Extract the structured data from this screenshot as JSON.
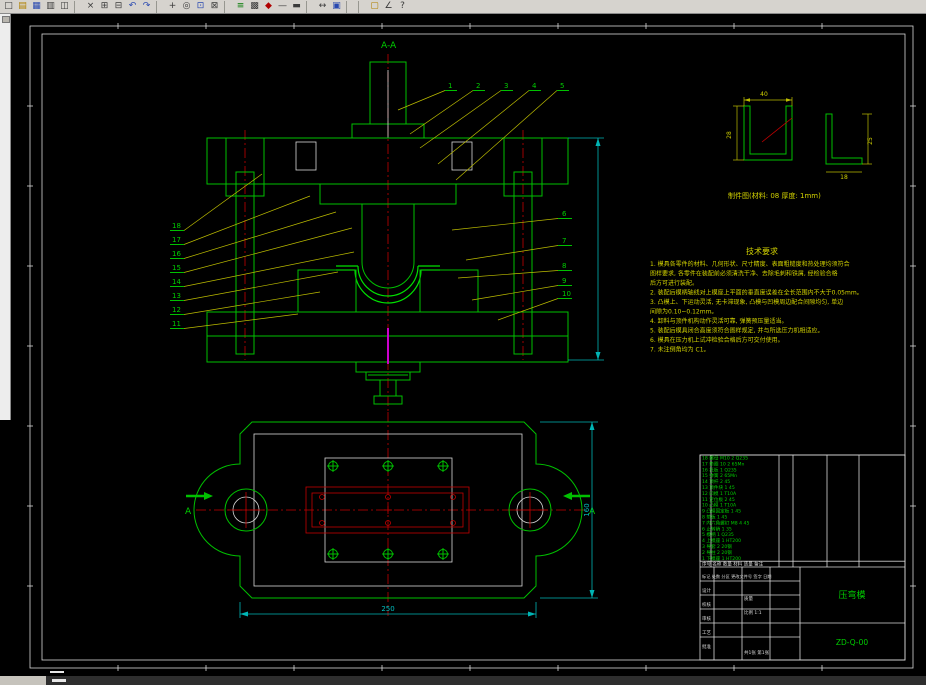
{
  "toolbar": {
    "icons": [
      {
        "n": "new-icon",
        "g": "□"
      },
      {
        "n": "open-icon",
        "g": "▤",
        "c": "#b08000"
      },
      {
        "n": "save-icon",
        "g": "▦",
        "c": "#2848b0"
      },
      {
        "n": "print-icon",
        "g": "▥"
      },
      {
        "n": "preview-icon",
        "g": "◫"
      },
      {
        "s": 1
      },
      {
        "n": "cut-icon",
        "g": "×"
      },
      {
        "n": "copy-icon",
        "g": "⊞"
      },
      {
        "n": "paste-icon",
        "g": "⊟"
      },
      {
        "n": "undo-icon",
        "g": "↶",
        "c": "#2848b0"
      },
      {
        "n": "redo-icon",
        "g": "↷",
        "c": "#2848b0"
      },
      {
        "s": 1
      },
      {
        "n": "pan-icon",
        "g": "+"
      },
      {
        "n": "zoom-realtime-icon",
        "g": "◎"
      },
      {
        "n": "zoom-window-icon",
        "g": "⊡",
        "c": "#2848b0"
      },
      {
        "n": "zoom-extents-icon",
        "g": "⊠"
      },
      {
        "s": 1
      },
      {
        "n": "layers-icon",
        "g": "≡",
        "c": "#007800"
      },
      {
        "n": "layer-control-icon",
        "g": "▩"
      },
      {
        "n": "color-control-icon",
        "g": "◆",
        "c": "#b00000"
      },
      {
        "n": "linetype-icon",
        "g": "—"
      },
      {
        "n": "lineweight-icon",
        "g": "▬"
      },
      {
        "s": 1
      },
      {
        "n": "distance-icon",
        "g": "↔"
      },
      {
        "n": "properties-icon",
        "g": "▣",
        "c": "#2848b0"
      },
      {
        "s": 1
      },
      {
        "s": 1
      },
      {
        "n": "style-icon",
        "g": "▢",
        "c": "#b08000"
      },
      {
        "n": "dim-style-icon",
        "g": "∠"
      },
      {
        "n": "help-icon",
        "g": "?"
      }
    ]
  },
  "drawing": {
    "section_title": "A-A",
    "detail_caption": "制件图(材料: 08  厚度: 1mm)",
    "detail_dims": {
      "w": "40",
      "h": "28",
      "leg": "25",
      "foot": "18"
    },
    "callouts": {
      "top": [
        "1",
        "2",
        "3",
        "4",
        "5"
      ],
      "right": [
        "6",
        "7",
        "8",
        "9",
        "10"
      ],
      "left": [
        "18",
        "17",
        "16",
        "15",
        "14",
        "13",
        "12",
        "11"
      ]
    },
    "tech": {
      "title": "技术要求",
      "lines": [
        "1. 模具各零件的材料、几何形状、尺寸精度、表面粗糙度和热处理均须符合",
        "   图样要求, 各零件在装配前必须清洗干净、去除毛刺和铁屑, 经检验合格",
        "   后方可进行装配。",
        "2. 装配后模柄轴线对上模座上平面的垂直度误差在全长范围内不大于0.05mm。",
        "3. 凸模上、下运动灵活, 无卡滞现象, 凸模与凹模周边配合间隙均匀, 单边",
        "   间隙为0.10~0.12mm。",
        "4. 卸料与顶件机构动作灵活可靠, 弹簧预压量适当。",
        "5. 装配后模具闭合高度须符合图样规定, 并与所选压力机相适应。",
        "6. 模具在压力机上试冲检验合格后方可交付使用。",
        "7. 未注倒角均为 C1。"
      ]
    },
    "plan": {
      "label_a_left": "A",
      "label_a_right": "A",
      "dim_width": "250",
      "dim_height": "160"
    },
    "title_block": {
      "name": "压弯模",
      "number": "ZD-Q-00",
      "header": "序号   名称   数量   材料   质量  备注",
      "parts": [
        "18  螺母 M10  2  Q235",
        "17  垫圈 10  2  65Mn",
        "16  托板  1  Q235",
        "15  弹簧  2  65Mn",
        "14  顶杆  2  45",
        "13  顶件块  1  45",
        "12  凹模  1  T10A",
        "11  定位板  2  45",
        "10  凸模  1  T10A",
        "9  凸模固定板  1  45",
        "8  垫板  1  45",
        "7  内六角螺钉 M8  4  45",
        "6  止转销  1  35",
        "5  模柄  1  Q235",
        "4  上模座  1  HT200",
        "3  导套  2  20钢",
        "2  导柱  2  20钢",
        "1  下模座  1  HT200"
      ],
      "labels": {
        "mark_row": "标记 处数 分区 更改文件号 签字 日期",
        "design": "设计",
        "check": "校核",
        "review": "审核",
        "craft": "工艺",
        "approve": "批准",
        "mass": "质量",
        "scale": "比例 1:1",
        "sheet": "共1张 第1张"
      }
    }
  }
}
